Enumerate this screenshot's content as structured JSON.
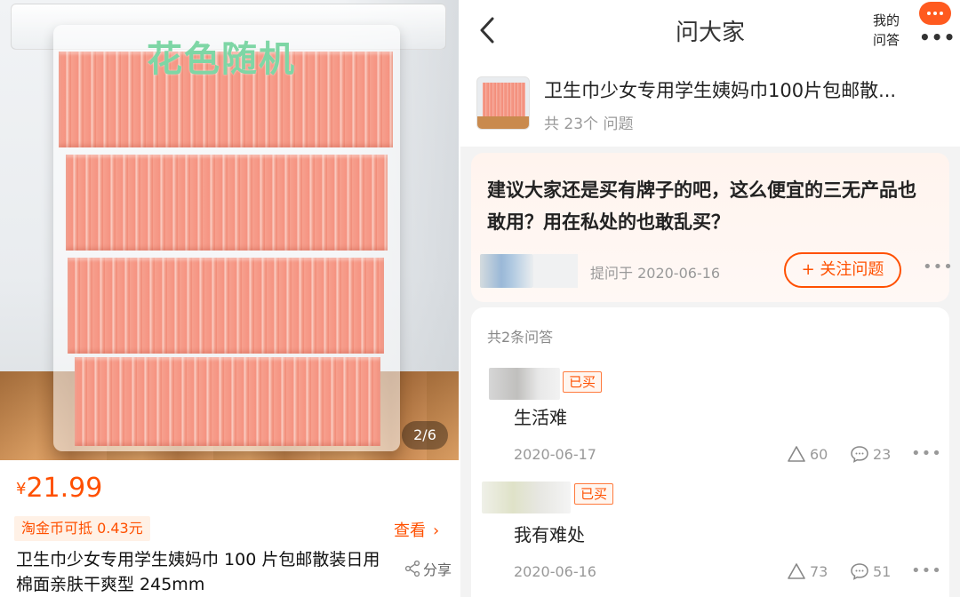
{
  "left": {
    "watermark": "花色随机",
    "page_indicator": "2/6",
    "price_symbol": "¥",
    "price": "21.99",
    "coin_badge": "淘金币可抵 0.43元",
    "view_link": "查看",
    "view_chevron": "›",
    "title": "卫生巾少女专用学生姨妈巾 100 片包邮散装日用棉面亲肤干爽型 245mm",
    "share_label": "分享",
    "share_icon": "share-icon"
  },
  "right": {
    "nav": {
      "title": "问大家",
      "back_icon": "chevron-left-icon",
      "my_qa_line1": "我的",
      "my_qa_line2": "问答",
      "more_icon": "more-dots-icon",
      "more_glyph": "•••"
    },
    "product": {
      "name": "卫生巾少女专用学生姨妈巾100片包邮散...",
      "question_count": "共 23个 问题"
    },
    "question": {
      "text": "建议大家还是买有牌子的吧，这么便宜的三无产品也敢用？用在私处的也敢乱买？",
      "ask_date": "提问于 2020-06-16",
      "follow_label": "+ 关注问题",
      "more_glyph": "•••"
    },
    "answers_header": "共2条问答",
    "answers": [
      {
        "badge": "已买",
        "text": "生活难",
        "date": "2020-06-17",
        "likes": "60",
        "comments": "23",
        "more_glyph": "•••"
      },
      {
        "badge": "已买",
        "text": "我有难处",
        "date": "2020-06-16",
        "likes": "73",
        "comments": "51",
        "more_glyph": "•••"
      }
    ]
  },
  "colors": {
    "accent": "#ff5000",
    "watermark": "#7ed6a5",
    "question_bg": "#fff4ee",
    "muted": "#999999"
  }
}
